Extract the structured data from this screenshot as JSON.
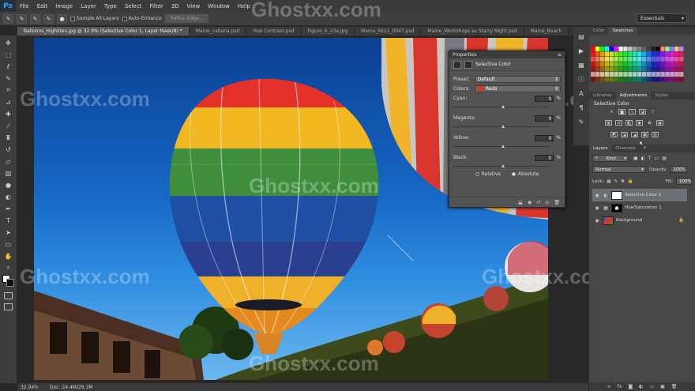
{
  "app": {
    "logo": "Ps"
  },
  "menu": [
    "File",
    "Edit",
    "Image",
    "Layer",
    "Type",
    "Select",
    "Filter",
    "3D",
    "View",
    "Window",
    "Help"
  ],
  "options": {
    "sample_all_layers": "Sample All Layers",
    "auto_enhance": "Auto-Enhance",
    "refine_edge": "Refine Edge...",
    "workspace": "Essentials"
  },
  "tabs": [
    {
      "label": "Balloons_Highlites.jpg @ 32.9% (Selective Color 1, Layer Mask/8) *",
      "active": true
    },
    {
      "label": "Maine_cabana.psd",
      "active": false
    },
    {
      "label": "Hue Contrast.psd",
      "active": false
    },
    {
      "label": "Figure_6_23a.jpg",
      "active": false
    },
    {
      "label": "Maine_9611_0047.psd",
      "active": false
    },
    {
      "label": "Maine_Workshops as Starry Night.psd",
      "active": false
    },
    {
      "label": "Maine_Beach",
      "active": false
    }
  ],
  "status": {
    "zoom": "32.94%",
    "doc": "Doc: 24.4M/29.3M"
  },
  "properties": {
    "panel_title": "Properties",
    "adjustment": "Selective Color",
    "preset_label": "Preset:",
    "preset_value": "Default",
    "colors_label": "Colors:",
    "colors_value": "Reds",
    "sliders": [
      {
        "label": "Cyan:",
        "value": "0",
        "unit": "%"
      },
      {
        "label": "Magenta:",
        "value": "0",
        "unit": "%"
      },
      {
        "label": "Yellow:",
        "value": "0",
        "unit": "%"
      },
      {
        "label": "Black:",
        "value": "0",
        "unit": "%"
      }
    ],
    "method_relative": "Relative",
    "method_absolute": "Absolute"
  },
  "right": {
    "tabs_top": [
      "Color",
      "Swatches"
    ],
    "tabs_mid": [
      "Libraries",
      "Adjustments",
      "Styles"
    ],
    "adjustments_title": "Selective Color",
    "tabs_layers": [
      "Layers",
      "Channels",
      "P"
    ],
    "kind": "Kind",
    "blend": "Normal",
    "opacity_label": "Opacity:",
    "opacity": "100%",
    "lock_label": "Lock:",
    "fill_label": "Fill:",
    "fill": "100%",
    "layers": [
      {
        "name": "Selective Color 1",
        "selected": true
      },
      {
        "name": "Hue/Saturation 1",
        "selected": false
      },
      {
        "name": "Background",
        "selected": false
      }
    ]
  },
  "watermark": "Ghostxx.com",
  "colors": {
    "accent": "#2fa3ff",
    "panel": "#535353",
    "chrome": "#3b3b3b"
  }
}
